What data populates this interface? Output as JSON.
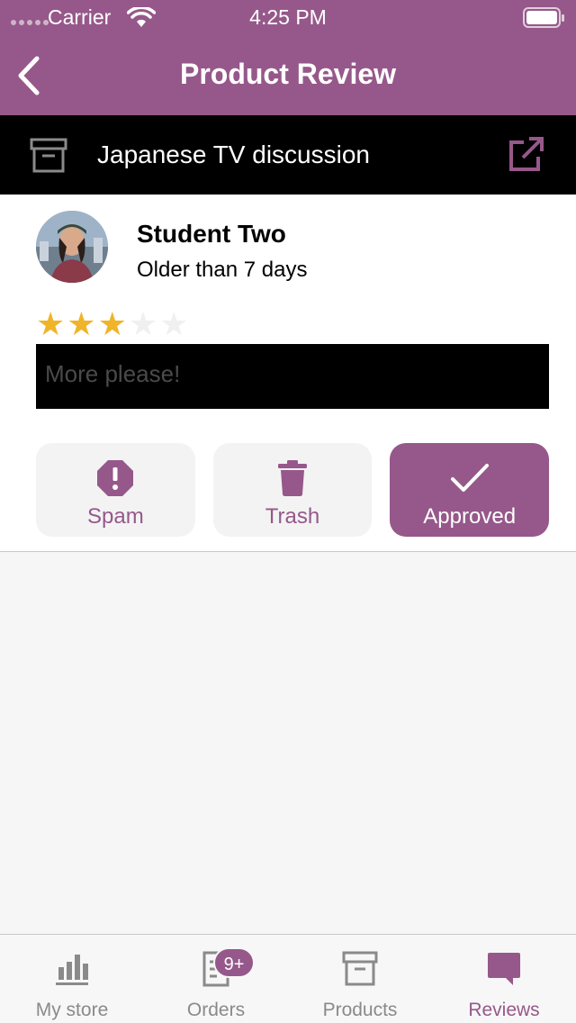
{
  "status_bar": {
    "carrier": "Carrier",
    "time": "4:25 PM"
  },
  "nav": {
    "title": "Product Review"
  },
  "product": {
    "name": "Japanese TV discussion"
  },
  "review": {
    "reviewer": "Student Two",
    "date": "Older than 7 days",
    "rating": 3,
    "rating_max": 5,
    "text": "More please!"
  },
  "actions": {
    "spam_label": "Spam",
    "trash_label": "Trash",
    "approved_label": "Approved"
  },
  "tabs": {
    "my_store": "My store",
    "orders": "Orders",
    "orders_badge": "9+",
    "products": "Products",
    "reviews": "Reviews"
  },
  "colors": {
    "accent": "#96588a",
    "star": "#f0b429",
    "tab_inactive": "#8a8a8a"
  }
}
